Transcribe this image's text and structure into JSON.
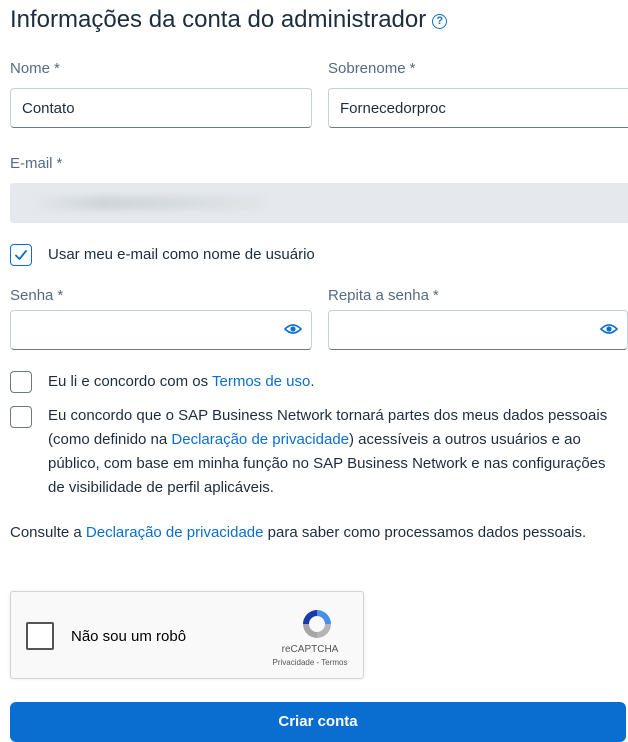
{
  "header": {
    "title": "Informações da conta do administrador",
    "help_icon": "question-circle-icon"
  },
  "first_name": {
    "label": "Nome",
    "required": "*",
    "value": "Contato"
  },
  "last_name": {
    "label": "Sobrenome",
    "required": "*",
    "value": "Fornecedorproc"
  },
  "email": {
    "label": "E-mail",
    "required": "*",
    "value": ""
  },
  "use_email_checkbox": {
    "label": "Usar meu e-mail como nome de usuário",
    "checked": true
  },
  "password": {
    "label": "Senha",
    "required": "*",
    "icon": "eye-icon"
  },
  "repeat_password": {
    "label": "Repita a senha",
    "required": "*",
    "icon": "eye-icon"
  },
  "terms": {
    "prefix": "Eu li e concordo com os ",
    "link": "Termos de uso",
    "suffix": ".",
    "checked": false
  },
  "privacy_consent": {
    "prefix": "Eu concordo que o SAP Business Network tornará partes dos meus dados pessoais (como definido na ",
    "link": "Declaração de privacidade",
    "suffix": ") acessíveis a outros usuários e ao público, com base em minha função no SAP Business Network e nas configurações de visibilidade de perfil aplicáveis.",
    "checked": false
  },
  "privacy_note": {
    "prefix": "Consulte a ",
    "link": "Declaração de privacidade",
    "suffix": " para saber como processamos dados pessoais."
  },
  "recaptcha": {
    "label": "Não sou um robô",
    "brand": "reCAPTCHA",
    "privacy": "Privacidade",
    "separator": " - ",
    "terms": "Termos"
  },
  "submit": {
    "label": "Criar conta"
  },
  "colors": {
    "accent": "#0a6ed1",
    "text": "#1d2d3e",
    "label": "#556b82"
  }
}
